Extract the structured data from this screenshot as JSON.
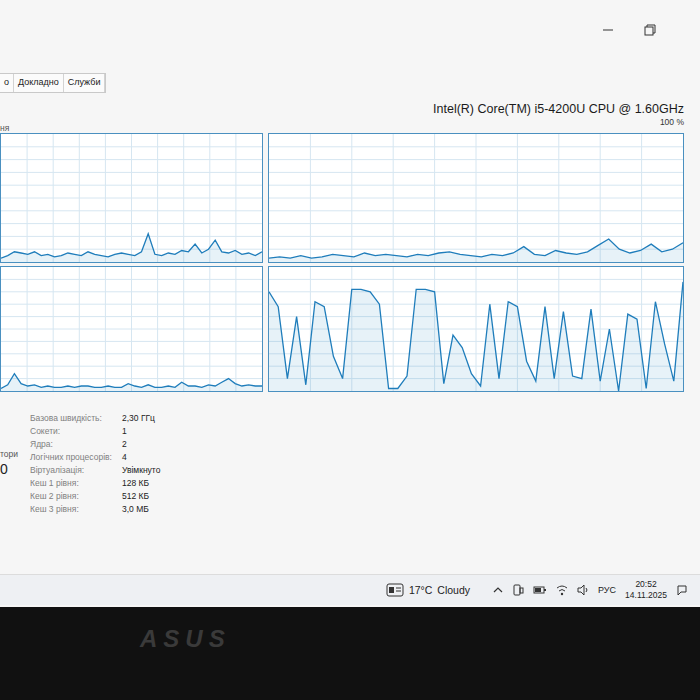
{
  "tabs": [
    {
      "label": "о",
      "selected": false
    },
    {
      "label": "Докладно",
      "selected": false
    },
    {
      "label": "Служби",
      "selected": false
    }
  ],
  "cpu": {
    "name": "Intel(R) Core(TM) i5-4200U CPU @ 1.60GHz",
    "max_label": "100 %",
    "graph_label": "ня"
  },
  "chart": {
    "graphs": [
      {
        "values": [
          3,
          5,
          8,
          7,
          6,
          8,
          5,
          6,
          4,
          5,
          7,
          6,
          5,
          8,
          6,
          5,
          4,
          6,
          7,
          6,
          5,
          8,
          22,
          6,
          5,
          7,
          6,
          9,
          8,
          14,
          7,
          10,
          17,
          8,
          7,
          9,
          6,
          7,
          5,
          8
        ]
      },
      {
        "values": [
          3,
          4,
          3,
          5,
          3,
          4,
          6,
          5,
          4,
          7,
          5,
          6,
          5,
          4,
          6,
          5,
          7,
          8,
          6,
          5,
          4,
          6,
          5,
          7,
          12,
          6,
          5,
          9,
          7,
          6,
          8,
          13,
          18,
          10,
          7,
          9,
          14,
          8,
          10,
          15
        ]
      },
      {
        "values": [
          2,
          5,
          14,
          6,
          4,
          5,
          3,
          4,
          3,
          3,
          4,
          3,
          4,
          4,
          3,
          3,
          4,
          3,
          3,
          6,
          4,
          3,
          5,
          3,
          3,
          4,
          3,
          7,
          4,
          4,
          3,
          5,
          4,
          7,
          10,
          6,
          4,
          5,
          4,
          4
        ]
      },
      {
        "values": [
          80,
          68,
          10,
          60,
          5,
          72,
          68,
          28,
          10,
          82,
          82,
          80,
          70,
          2,
          2,
          12,
          82,
          82,
          80,
          6,
          45,
          35,
          14,
          4,
          70,
          10,
          72,
          68,
          24,
          8,
          68,
          10,
          64,
          12,
          10,
          66,
          8,
          50,
          0,
          62,
          58,
          2,
          72,
          38,
          8,
          88
        ]
      }
    ]
  },
  "left_cut": [
    "тори",
    "0"
  ],
  "specs": [
    {
      "label": "Базова швидкість:",
      "value": "2,30 ГГц"
    },
    {
      "label": "Сокети:",
      "value": "1"
    },
    {
      "label": "Ядра:",
      "value": "2"
    },
    {
      "label": "Логічних процесорів:",
      "value": "4"
    },
    {
      "label": "Віртуалізація:",
      "value": "Увімкнуто"
    },
    {
      "label": "Кеш 1 рівня:",
      "value": "128 КБ"
    },
    {
      "label": "Кеш 2 рівня:",
      "value": "512 КБ"
    },
    {
      "label": "Кеш 3 рівня:",
      "value": "3,0 МБ"
    }
  ],
  "taskbar": {
    "temperature": "17°C",
    "weather": "Cloudy",
    "language": "РУС",
    "time": "20:52",
    "date": "14.11.2025"
  },
  "bezel": {
    "logo": "ASUS"
  }
}
